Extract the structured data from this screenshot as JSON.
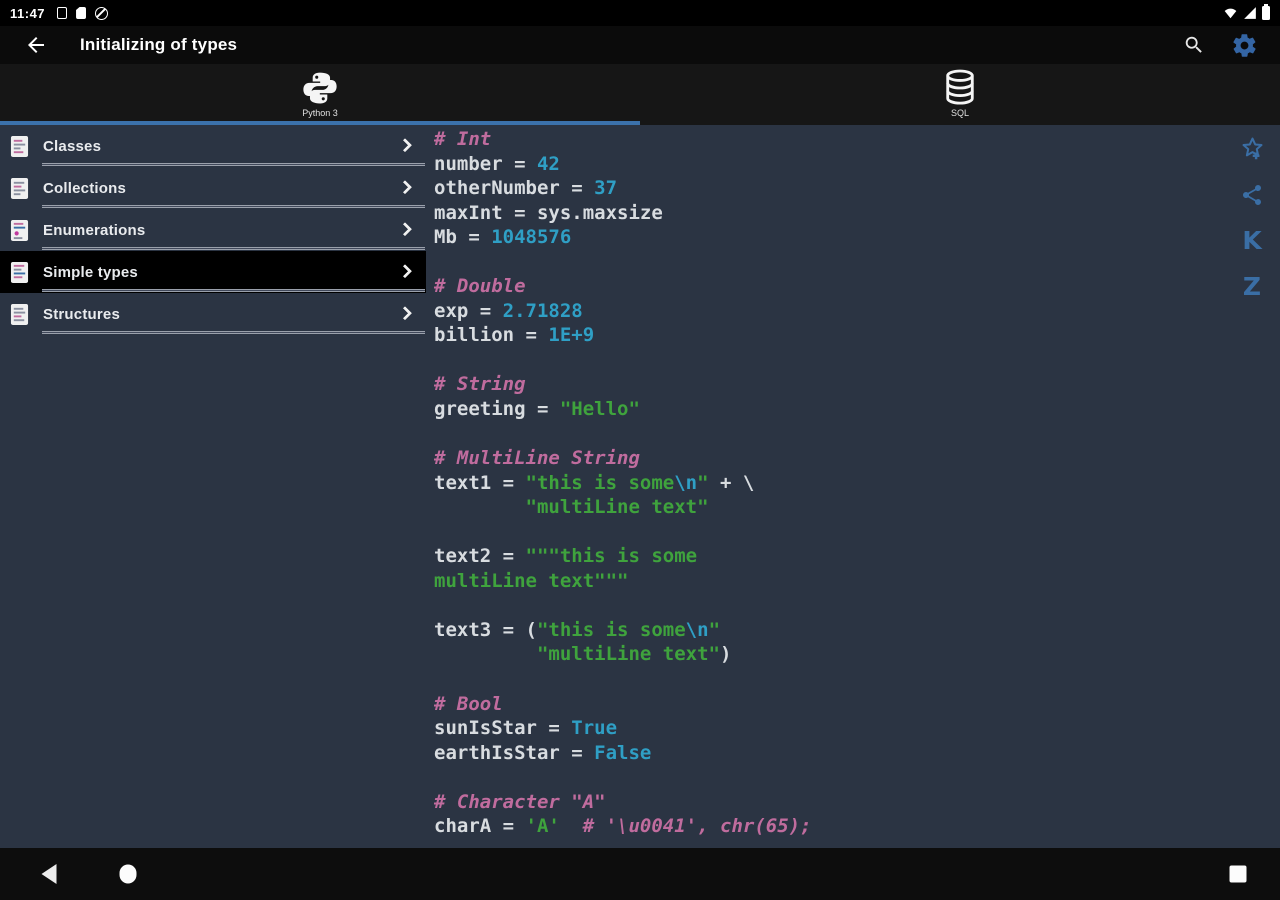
{
  "status_bar": {
    "time": "11:47",
    "left_icons": [
      "app-notification",
      "sd-card",
      "data-saver-off"
    ],
    "right_icons": [
      "wifi",
      "cell-signal",
      "battery"
    ]
  },
  "app_bar": {
    "title": "Initializing of types",
    "icons": [
      "back-arrow",
      "search",
      "settings-gear"
    ]
  },
  "tabs": [
    {
      "label": "Python 3",
      "icon": "python-logo",
      "selected": true
    },
    {
      "label": "SQL",
      "icon": "database",
      "selected": false
    }
  ],
  "sidebar": {
    "items": [
      {
        "label": "Classes",
        "selected": false
      },
      {
        "label": "Collections",
        "selected": false
      },
      {
        "label": "Enumerations",
        "selected": false
      },
      {
        "label": "Simple types",
        "selected": true
      },
      {
        "label": "Structures",
        "selected": false
      }
    ]
  },
  "action_rail": {
    "icons": [
      "favorite-add-star",
      "share",
      "letter-k",
      "letter-z"
    ],
    "letter_k": "K",
    "letter_z": "Z"
  },
  "nav_bar": {
    "icons": [
      "back-triangle",
      "home-circle",
      "recents-square"
    ]
  },
  "colors": {
    "bg": "#2b3443",
    "accent": "#3b71ab",
    "rail": "#3a6ea5",
    "selected": "#000000",
    "comment": "#c06c9e",
    "plain": "#d8dce0",
    "number": "#2f9fc5",
    "string": "#3fa33d",
    "escape": "#2f9fc5"
  },
  "code": {
    "language": "Python 3",
    "lines": [
      [
        {
          "t": "# Int",
          "y": "comment"
        }
      ],
      [
        {
          "t": "number = ",
          "y": "plain"
        },
        {
          "t": "42",
          "y": "number"
        }
      ],
      [
        {
          "t": "otherNumber = ",
          "y": "plain"
        },
        {
          "t": "37",
          "y": "number"
        }
      ],
      [
        {
          "t": "maxInt = sys.maxsize",
          "y": "plain"
        }
      ],
      [
        {
          "t": "Mb = ",
          "y": "plain"
        },
        {
          "t": "1048576",
          "y": "number"
        }
      ],
      [],
      [
        {
          "t": "# Double",
          "y": "comment"
        }
      ],
      [
        {
          "t": "exp = ",
          "y": "plain"
        },
        {
          "t": "2.71828",
          "y": "number"
        }
      ],
      [
        {
          "t": "billion = ",
          "y": "plain"
        },
        {
          "t": "1E+9",
          "y": "number"
        }
      ],
      [],
      [
        {
          "t": "# String",
          "y": "comment"
        }
      ],
      [
        {
          "t": "greeting = ",
          "y": "plain"
        },
        {
          "t": "\"Hello\"",
          "y": "string"
        }
      ],
      [],
      [
        {
          "t": "# MultiLine String",
          "y": "comment"
        }
      ],
      [
        {
          "t": "text1 = ",
          "y": "plain"
        },
        {
          "t": "\"this is some",
          "y": "string"
        },
        {
          "t": "\\n",
          "y": "escape"
        },
        {
          "t": "\"",
          "y": "string"
        },
        {
          "t": " + \\",
          "y": "plain"
        }
      ],
      [
        {
          "t": "        ",
          "y": "plain"
        },
        {
          "t": "\"multiLine text\"",
          "y": "string"
        }
      ],
      [],
      [
        {
          "t": "text2 = ",
          "y": "plain"
        },
        {
          "t": "\"\"\"this is some",
          "y": "string"
        }
      ],
      [
        {
          "t": "multiLine text\"\"\"",
          "y": "string"
        }
      ],
      [],
      [
        {
          "t": "text3 = (",
          "y": "plain"
        },
        {
          "t": "\"this is some",
          "y": "string"
        },
        {
          "t": "\\n",
          "y": "escape"
        },
        {
          "t": "\"",
          "y": "string"
        }
      ],
      [
        {
          "t": "         ",
          "y": "plain"
        },
        {
          "t": "\"multiLine text\"",
          "y": "string"
        },
        {
          "t": ")",
          "y": "plain"
        }
      ],
      [],
      [
        {
          "t": "# Bool",
          "y": "comment"
        }
      ],
      [
        {
          "t": "sunIsStar = ",
          "y": "plain"
        },
        {
          "t": "True",
          "y": "number"
        }
      ],
      [
        {
          "t": "earthIsStar = ",
          "y": "plain"
        },
        {
          "t": "False",
          "y": "number"
        }
      ],
      [],
      [
        {
          "t": "# Character \"A\"",
          "y": "comment"
        }
      ],
      [
        {
          "t": "charA = ",
          "y": "plain"
        },
        {
          "t": "'A'",
          "y": "string"
        },
        {
          "t": "  ",
          "y": "plain"
        },
        {
          "t": "# '\\u0041', chr(65);",
          "y": "comment"
        }
      ]
    ]
  }
}
